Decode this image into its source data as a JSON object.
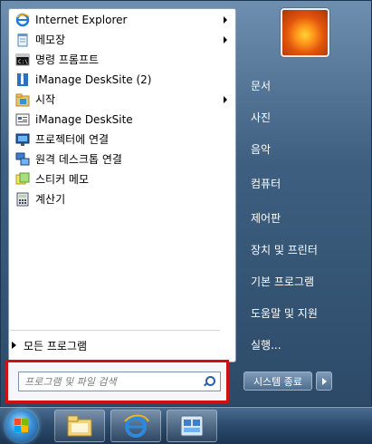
{
  "programs": [
    {
      "label": "Internet Explorer",
      "has_submenu": true,
      "icon": "ie-icon"
    },
    {
      "label": "메모장",
      "has_submenu": true,
      "icon": "notepad-icon"
    },
    {
      "label": "명령 프롬프트",
      "has_submenu": false,
      "icon": "cmd-icon"
    },
    {
      "label": "iManage DeskSite (2)",
      "has_submenu": false,
      "icon": "imanage-icon"
    },
    {
      "label": "시작",
      "has_submenu": true,
      "icon": "startup-icon"
    },
    {
      "label": "iManage DeskSite",
      "has_submenu": false,
      "icon": "imanage-icon"
    },
    {
      "label": "프로젝터에 연결",
      "has_submenu": false,
      "icon": "projector-icon"
    },
    {
      "label": "원격 데스크톱 연결",
      "has_submenu": false,
      "icon": "remote-desktop-icon"
    },
    {
      "label": "스티커 메모",
      "has_submenu": false,
      "icon": "sticky-notes-icon"
    },
    {
      "label": "계산기",
      "has_submenu": false,
      "icon": "calculator-icon"
    }
  ],
  "all_programs_label": "모든 프로그램",
  "search": {
    "placeholder": "프로그램 및 파일 검색"
  },
  "right_links": [
    "문서",
    "사진",
    "음악",
    "컴퓨터",
    "제어판",
    "장치 및 프린터",
    "기본 프로그램",
    "도움말 및 지원",
    "실행..."
  ],
  "shutdown_label": "시스템 종료",
  "colors": {
    "highlight_border": "#d01010",
    "right_text": "#ffffff"
  }
}
